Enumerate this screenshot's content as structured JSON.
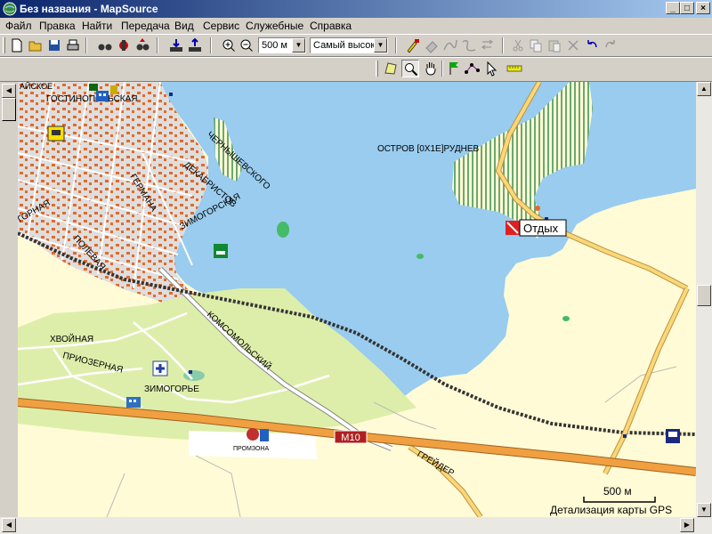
{
  "window": {
    "title": "Без названия - MapSource"
  },
  "menu": [
    "Файл",
    "Правка",
    "Найти",
    "Передача",
    "Вид",
    "Сервис",
    "Служебные",
    "Справка"
  ],
  "toolbar": {
    "scale_value": "500 м",
    "detail_value": "Самый высокий"
  },
  "map": {
    "labels": {
      "aiskoe": "АЙСКОЕ",
      "gostinopol": "ГОСТИНОПОЛЬСКАЯ",
      "chernyshevskogo": "ЧЕРНЫШЕВСКОГО",
      "dekabristov": "ДЕКАБРИСТОВ",
      "germana": "ГЕРМАНА",
      "zimogorskaya": "ЗИМОГОРСКАЯ",
      "gornaya": "ГОРНАЯ",
      "polevaya": "ПОЛЕВАЯ",
      "komsomolsky": "КОМСОМОЛЬСКИЙ",
      "khvoinaya": "ХВОЙНАЯ",
      "priozernaya": "ПРИОЗЕРНАЯ",
      "zimogorye": "ЗИМОГОРЬЕ",
      "promzona": "ПРОМЗОНА",
      "greider": "ГРЕЙДЕР",
      "island": "ОСТРОВ [0X1E]РУДНЕВ",
      "otdykh": "Отдых",
      "road_m10": "M10"
    },
    "scale_label": "500 м",
    "detail_note": "Детализация карты GPS"
  },
  "colors": {
    "water": "#99ccee",
    "land": "#fffbd6",
    "urban": "#dedede",
    "park": "#ddeeaa",
    "road_major": "#f0a040",
    "road_minor": "#ffffff",
    "road_dirt": "#f8d878"
  }
}
